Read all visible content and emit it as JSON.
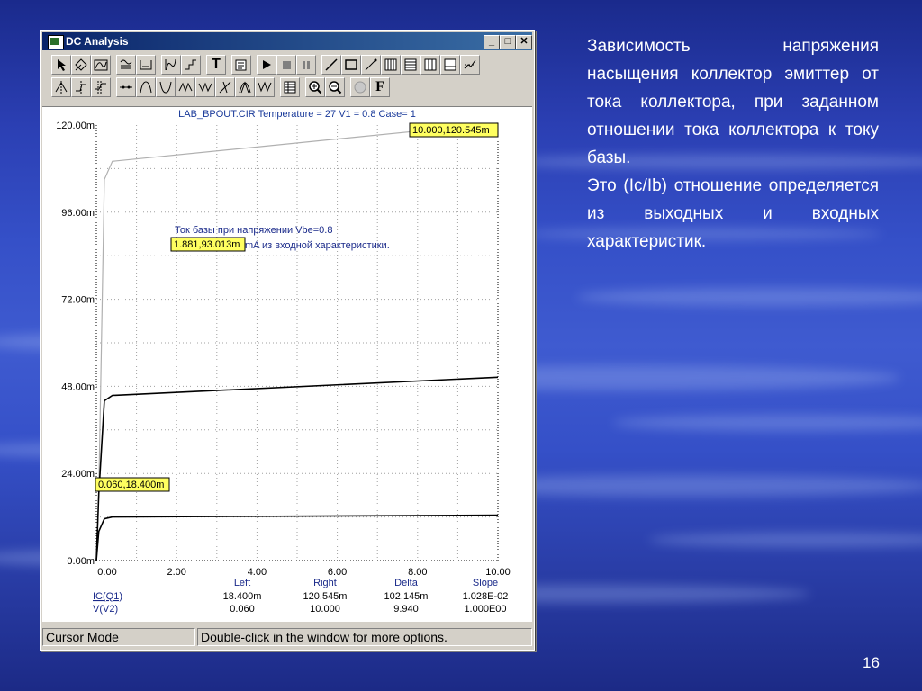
{
  "window": {
    "title": "DC Analysis",
    "buttons": {
      "minimize": "_",
      "maximize": "□",
      "close": "✕"
    }
  },
  "toolbar": {
    "row1": [
      "pointer-icon",
      "cursor-grid-icon",
      "wave-icon",
      "scale-icon",
      "graph-icon",
      "axis-icon",
      "step-icon",
      "text-tool",
      "properties-icon",
      "play-icon",
      "stop-icon",
      "pause-icon",
      "line-icon",
      "rectangle-icon",
      "diagonal-icon",
      "grid-icon",
      "minor-grid-icon",
      "toggle-grid-icon",
      "legend-icon",
      "trace-icon"
    ],
    "row2": [
      "peak-icon",
      "valley-icon",
      "high-icon",
      "cursor-mode-icon",
      "peak-search-icon",
      "valley-search-icon",
      "slope-icon",
      "inflection-icon",
      "max-icon",
      "min-icon",
      "tabulate-icon",
      "zoom-in-icon",
      "zoom-out-icon",
      "info-icon",
      "font-icon"
    ],
    "text_label": "T",
    "font_label": "F"
  },
  "plot": {
    "header": "LAB_BPOUT.CIR Temperature = 27 V1 = 0.8 Case= 1",
    "y_ticks": [
      "0.00m",
      "24.00m",
      "48.00m",
      "72.00m",
      "96.00m",
      "120.00m"
    ],
    "x_ticks": [
      "0.00",
      "2.00",
      "4.00",
      "6.00",
      "8.00",
      "10.00"
    ],
    "annotation_line1": "Ток базы при напряжении Vbe=0.8",
    "annotation_line2": "mA из входной характеристики.",
    "tag_annotation": "1.881,93.013m",
    "tag_right": "10.000,120.545m",
    "tag_left": "0.060,18.400m",
    "cursor_table": {
      "headers": [
        "Left",
        "Right",
        "Delta",
        "Slope"
      ],
      "rows": [
        {
          "name": "IC(Q1)",
          "values": [
            "18.400m",
            "120.545m",
            "102.145m",
            "1.028E-02"
          ]
        },
        {
          "name": "V(V2)",
          "values": [
            "0.060",
            "10.000",
            "9.940",
            "1.000E00"
          ]
        }
      ]
    }
  },
  "chart_data": {
    "type": "line",
    "title": "LAB_BPOUT.CIR Temperature = 27 V1 = 0.8 Case= 1",
    "xlabel": "",
    "ylabel": "",
    "xlim": [
      0,
      10
    ],
    "ylim": [
      0,
      0.12
    ],
    "grid": true,
    "series": [
      {
        "color": "#b0b0b0",
        "x": [
          0,
          0.06,
          0.2,
          0.4,
          10
        ],
        "y": [
          0,
          0.0184,
          0.105,
          0.11,
          0.12055
        ]
      },
      {
        "color": "#000000",
        "x": [
          0,
          0.06,
          0.2,
          0.4,
          10
        ],
        "y": [
          0,
          0.0184,
          0.044,
          0.0455,
          0.0505
        ]
      },
      {
        "color": "#000000",
        "x": [
          0,
          0.06,
          0.2,
          0.4,
          10
        ],
        "y": [
          0,
          0.008,
          0.0115,
          0.012,
          0.0125
        ]
      }
    ]
  },
  "status": {
    "mode": "Cursor Mode",
    "hint": "Double-click in the window for more options."
  },
  "side": {
    "para1": "Зависимость напряжения насыщения коллектор эмиттер от тока коллектора, при заданном отношении тока коллектора к току базы.",
    "para2": "Это (Ic/Ib) отношение определяется из выходных и входных характеристик."
  },
  "page_number": "16"
}
